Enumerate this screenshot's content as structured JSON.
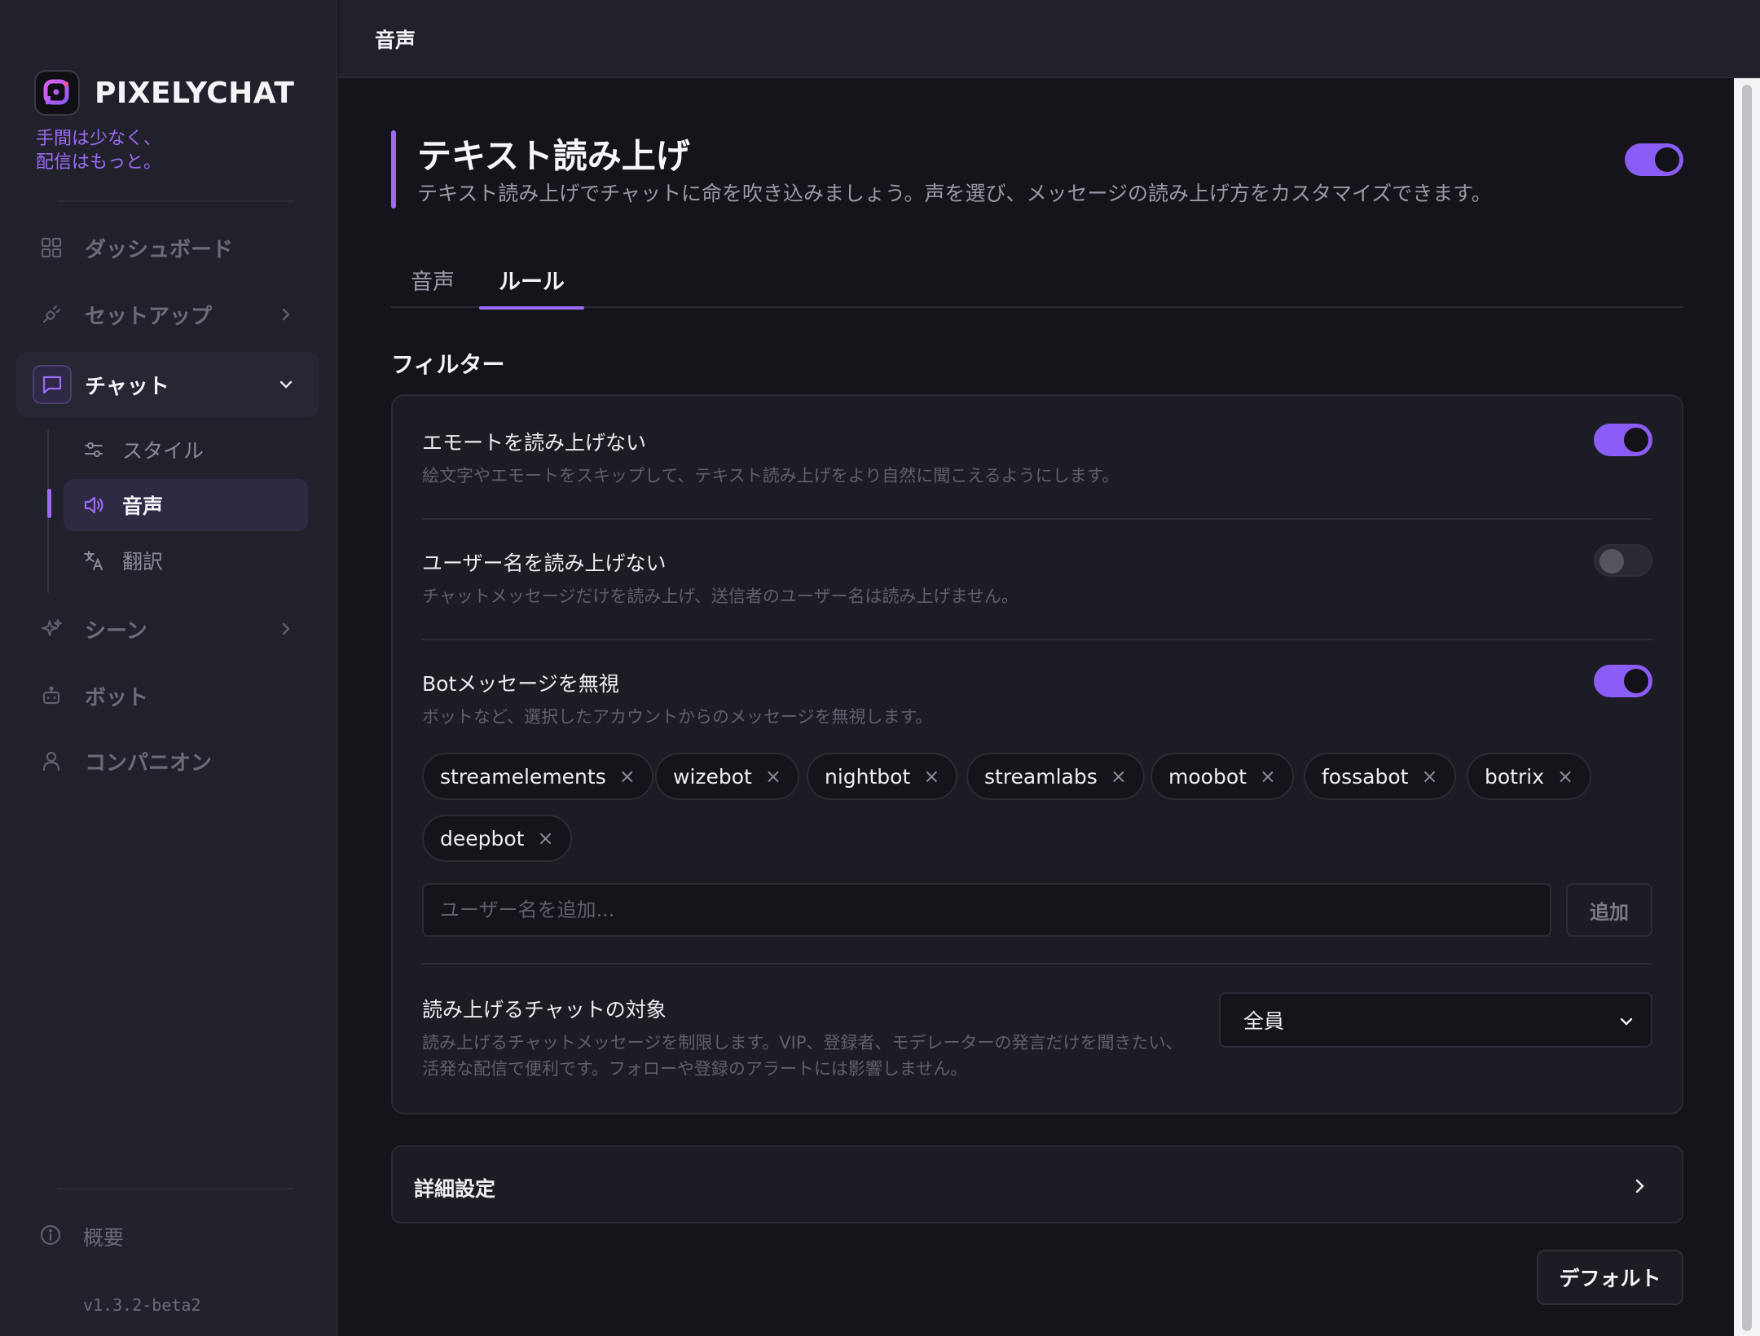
{
  "app": {
    "name": "PIXELYCHAT",
    "tagline": "手間は少なく、\n配信はもっと。",
    "version": "v1.3.2-beta2",
    "accent": "#9b6bf5"
  },
  "sidebar": {
    "items": [
      {
        "label": "ダッシュボード",
        "icon": "grid-icon"
      },
      {
        "label": "セットアップ",
        "icon": "plug-icon"
      },
      {
        "label": "チャット",
        "icon": "chat-icon"
      },
      {
        "label": "シーン",
        "icon": "sparkle-icon"
      },
      {
        "label": "ボット",
        "icon": "robot-icon"
      },
      {
        "label": "コンパニオン",
        "icon": "user-icon"
      }
    ],
    "chat_sub": [
      {
        "label": "スタイル",
        "icon": "sliders-icon"
      },
      {
        "label": "音声",
        "icon": "speaker-icon"
      },
      {
        "label": "翻訳",
        "icon": "translate-icon"
      }
    ],
    "about_label": "概要"
  },
  "topbar": {
    "title": "音声"
  },
  "hero": {
    "title": "テキスト読み上げ",
    "description": "テキスト読み上げでチャットに命を吹き込みましょう。声を選び、メッセージの読み上げ方をカスタマイズできます。",
    "enabled": true
  },
  "tabs": [
    {
      "label": "音声",
      "active": false
    },
    {
      "label": "ルール",
      "active": true
    }
  ],
  "filters": {
    "title": "フィルター",
    "rows": [
      {
        "title": "エモートを読み上げない",
        "description": "絵文字やエモートをスキップして、テキスト読み上げをより自然に聞こえるようにします。",
        "enabled": true
      },
      {
        "title": "ユーザー名を読み上げない",
        "description": "チャットメッセージだけを読み上げ、送信者のユーザー名は読み上げません。",
        "enabled": false
      },
      {
        "title": "Botメッセージを無視",
        "description": "ボットなど、選択したアカウントからのメッセージを無視します。",
        "enabled": true
      }
    ],
    "ignored_bots": [
      "streamelements",
      "wizebot",
      "nightbot",
      "streamlabs",
      "moobot",
      "fossabot",
      "botrix",
      "deepbot"
    ],
    "chip_remove_glyph": "×",
    "add_placeholder": "ユーザー名を追加...",
    "add_button": "追加",
    "audience": {
      "title": "読み上げるチャットの対象",
      "description": "読み上げるチャットメッセージを制限します。VIP、登録者、モデレーターの発言だけを聞きたい、活発な配信で便利です。フォローや登録のアラートには影響しません。",
      "selected": "全員"
    }
  },
  "advanced": {
    "label": "詳細設定"
  },
  "default_button": "デフォルト"
}
